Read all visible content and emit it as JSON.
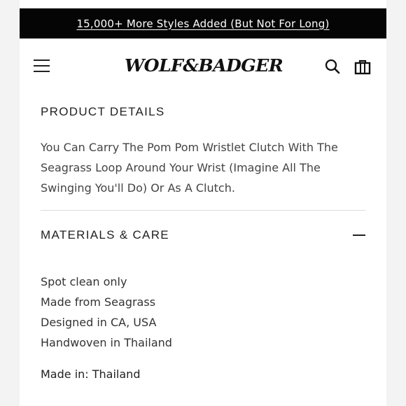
{
  "promo_banner": {
    "text": "15,000+ More Styles Added (But Not For Long)"
  },
  "header": {
    "logo_text": "WOLF&BADGER",
    "menu_icon": "hamburger-menu-icon",
    "search_icon": "search-icon",
    "bag_icon": "shopping-bag-icon"
  },
  "product_details": {
    "title": "PRODUCT DETAILS",
    "description": "You Can Carry The Pom Pom Wristlet Clutch With The Seagrass Loop Around Your Wrist (Imagine All The Swinging You'll Do) Or As A Clutch."
  },
  "materials_care": {
    "title": "MATERIALS & CARE",
    "toggle_icon": "minus-collapse-icon",
    "items": [
      "Spot clean only",
      "Made from Seagrass",
      "Designed in CA, USA",
      "Handwoven in Thailand"
    ],
    "made_in": "Made in: Thailand"
  },
  "colors": {
    "banner_bg": "#050505",
    "page_bg": "#ffffff",
    "outer_bg": "#f3f3f3",
    "divider": "#dddddd"
  }
}
